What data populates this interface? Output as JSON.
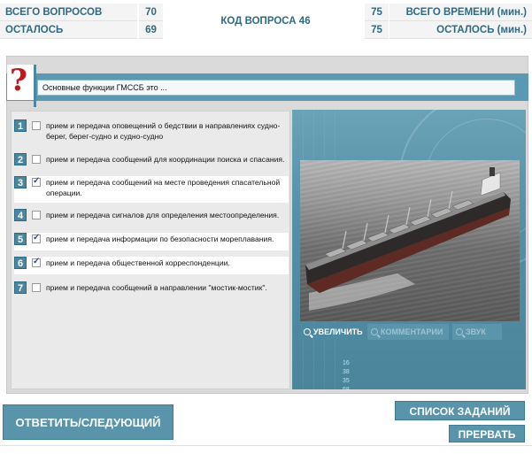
{
  "header": {
    "total_questions_label": "ВСЕГО ВОПРОСОВ",
    "total_questions_value": "70",
    "remaining_label": "ОСТАЛОСЬ",
    "remaining_value": "69",
    "question_code": "КОД ВОПРОСА 46",
    "total_time_value": "75",
    "total_time_label": "ВСЕГО ВРЕМЕНИ (мин.)",
    "remaining_time_value": "75",
    "remaining_time_label": "ОСТАЛОСЬ (мин.)"
  },
  "question": {
    "icon": "question-mark-icon",
    "text": "Основные функции ГМССБ это ..."
  },
  "answers": [
    {
      "num": "1",
      "checked": false,
      "text": "прием и передача оповещений о бедствии в направлениях судно-берег, берег-судно и судно-судно"
    },
    {
      "num": "2",
      "checked": false,
      "text": "прием и передача сообщений для координации поиска и спасания."
    },
    {
      "num": "3",
      "checked": true,
      "text": "прием и передача сообщений на месте проведения спасательной операции."
    },
    {
      "num": "4",
      "checked": false,
      "text": "прием и передача сигналов для определения местоопределения."
    },
    {
      "num": "5",
      "checked": true,
      "text": "прием и передача информации по безопасности мореплавания."
    },
    {
      "num": "6",
      "checked": true,
      "text": "прием и передача общественной корреспонденции."
    },
    {
      "num": "7",
      "checked": false,
      "text": "прием и передача сообщений в направлении \"мостик-мостик\"."
    }
  ],
  "image_panel": {
    "zoom_label": "УВЕЛИЧИТЬ",
    "comments_label": "КОММЕНТАРИИ",
    "sound_label": "ЗВУК",
    "deco_numbers": [
      "16",
      "38",
      "35",
      "68"
    ]
  },
  "buttons": {
    "answer_next": "ОТВЕТИТЬ/СЛЕДУЮЩИЙ",
    "task_list": "СПИСОК ЗАДАНИЙ",
    "interrupt": "ПРЕРВАТЬ"
  },
  "colors": {
    "accent": "#5a94aa",
    "header_text": "#2f6a82",
    "question_mark": "#c4161c"
  }
}
